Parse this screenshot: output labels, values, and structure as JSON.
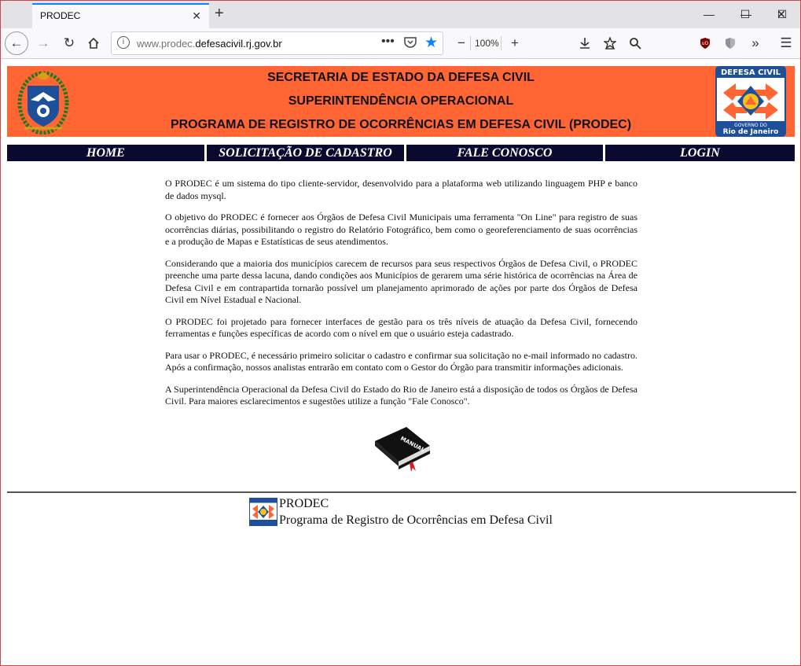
{
  "browser": {
    "tab_title": "PRODEC",
    "url_host_prefix": "www.prodec.",
    "url_host_main": "defesacivil.rj.gov.br",
    "zoom": "100%",
    "icons": {
      "back": "arrow-left-icon",
      "forward": "arrow-right-icon",
      "reload": "reload-icon",
      "home": "home-icon",
      "info": "info-icon",
      "more": "ellipsis-icon",
      "pocket": "pocket-icon",
      "bookmark": "star-icon",
      "download": "download-icon",
      "library": "library-icon",
      "search": "search-icon",
      "ublock": "ublock-icon",
      "shield": "shield-icon",
      "overflow": "chevron-double-right-icon",
      "menu": "hamburger-menu-icon"
    }
  },
  "header": {
    "line1": "SECRETARIA DE ESTADO DA DEFESA CIVIL",
    "line2": "SUPERINTENDÊNCIA OPERACIONAL",
    "line3": "PROGRAMA DE REGISTRO DE OCORRÊNCIAS EM DEFESA CIVIL (PRODEC)",
    "logo_top": "DEFESA CIVIL",
    "logo_bottom1": "GOVERNO DO",
    "logo_bottom2": "Rio de Janeiro",
    "banner_color": "#ff6633"
  },
  "nav": {
    "home": "HOME",
    "signup": "SOLICITAÇÃO DE CADASTRO",
    "contact": "FALE CONOSCO",
    "login": "LOGIN"
  },
  "content": {
    "p1": "O PRODEC é um sistema do tipo cliente-servidor, desenvolvido para a plataforma web utilizando linguagem PHP e banco de dados mysql.",
    "p2": "O objetivo do PRODEC é fornecer aos Órgãos de Defesa Civil Municipais uma ferramenta \"On Line\" para registro de suas ocorrências diárias, possibilitando o registro do Relatório Fotográfico, bem como o georeferenciamento de suas ocorrências e a produção de Mapas e Estatísticas de seus atendimentos.",
    "p3": "Considerando que a maioria dos municípios carecem de recursos para seus respectivos Órgãos de Defesa Civil, o PRODEC preenche uma parte dessa lacuna, dando condições aos Municípios de gerarem uma série histórica de ocorrências na Área de Defesa Civil e em contrapartida tornarão possível um planejamento aprimorado de ações por parte dos Órgãos de Defesa Civil em Nível Estadual e Nacional.",
    "p4": "O PRODEC foi projetado para fornecer interfaces de gestão para os três níveis de atuação da Defesa Civil, fornecendo ferramentas e funções específicas de acordo com o nível em que o usuário esteja cadastrado.",
    "p5": "Para usar o PRODEC, é necessário primeiro solicitar o cadastro e confirmar sua solicitação no e-mail informado no cadastro. Após a confirmação, nossos analistas entrarão em contato com o Gestor do Órgão para transmitir informações adicionais.",
    "p6": "A Superintendência Operacional da Defesa Civil do Estado do Rio de Janeiro está a disposição de todos os Órgãos de Defesa Civil. Para maiores esclarecimentos e sugestões utilize a função \"Fale Conosco\".",
    "manual_label": "MANUAL"
  },
  "footer": {
    "title": "PRODEC",
    "subtitle": "Programa de Registro de Ocorrências em Defesa Civil"
  }
}
